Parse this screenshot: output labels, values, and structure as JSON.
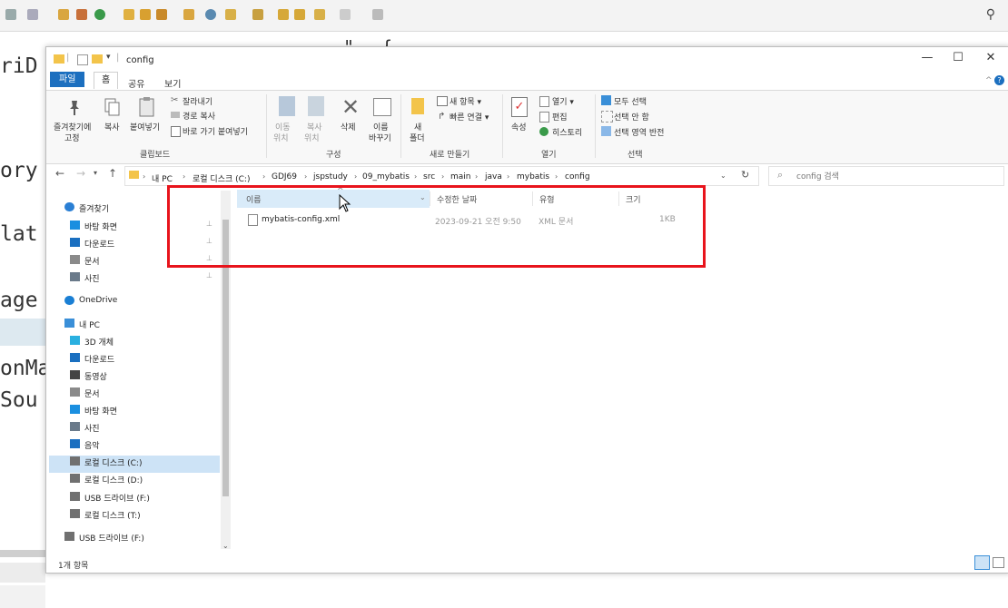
{
  "eclipse": {
    "search_icon": "search-icon",
    "code_lines": [
      "riD",
      "ory",
      "lat",
      "age",
      "onMa",
      "Sou"
    ],
    "code_fragment": "\"",
    "code_fragment2": "{"
  },
  "window": {
    "title": "config",
    "minimize": "—",
    "maximize": "☐",
    "close": "✕",
    "help": "?",
    "collapse": "^"
  },
  "ribbon": {
    "tabs": [
      "파일",
      "홈",
      "공유",
      "보기"
    ],
    "clipboard": {
      "pin_label_1": "즐겨찾기에",
      "pin_label_2": "고정",
      "copy": "복사",
      "paste": "붙여넣기",
      "cut": "잘라내기",
      "copy_path": "경로 복사",
      "paste_shortcut": "바로 가기 붙여넣기"
    },
    "organize": {
      "move_to_1": "이동",
      "move_to_2": "위치",
      "copy_to_1": "복사",
      "copy_to_2": "위치",
      "delete": "삭제",
      "rename_1": "이름",
      "rename_2": "바꾸기"
    },
    "new": {
      "new_folder_1": "새",
      "new_folder_2": "폴더",
      "new_item": "새 항목 ▾",
      "easy_access": "빠른 연결 ▾"
    },
    "open": {
      "properties": "속성",
      "open": "열기 ▾",
      "edit": "편집",
      "history": "히스토리"
    },
    "select": {
      "select_all": "모두 선택",
      "select_none": "선택 안 함",
      "invert": "선택 영역 반전"
    },
    "groups": [
      "클립보드",
      "구성",
      "새로 만들기",
      "열기",
      "선택"
    ]
  },
  "address": {
    "breadcrumbs": [
      "내 PC",
      "로컬 디스크 (C:)",
      "GDJ69",
      "jspstudy",
      "09_mybatis",
      "src",
      "main",
      "java",
      "mybatis",
      "config"
    ],
    "search_placeholder": "config 검색"
  },
  "nav": {
    "items": [
      {
        "label": "즐겨찾기",
        "icon": "star-icon",
        "color": "#2a7fd4"
      },
      {
        "label": "바탕 화면",
        "icon": "desktop-icon",
        "color": "#1a8fe0",
        "pinned": true
      },
      {
        "label": "다운로드",
        "icon": "download-icon",
        "color": "#1a6fc0",
        "pinned": true
      },
      {
        "label": "문서",
        "icon": "document-icon",
        "color": "#8a8a8a",
        "pinned": true
      },
      {
        "label": "사진",
        "icon": "pictures-icon",
        "color": "#6a7a8a",
        "pinned": true
      },
      {
        "label": "OneDrive",
        "icon": "cloud-icon",
        "color": "#1a7fd4"
      },
      {
        "label": "내 PC",
        "icon": "computer-icon",
        "color": "#3a8fd8"
      },
      {
        "label": "3D 개체",
        "icon": "cube-icon",
        "color": "#2ab0e0"
      },
      {
        "label": "다운로드",
        "icon": "download-icon",
        "color": "#1a6fc0"
      },
      {
        "label": "동영상",
        "icon": "video-icon",
        "color": "#444444"
      },
      {
        "label": "문서",
        "icon": "document-icon",
        "color": "#8a8a8a"
      },
      {
        "label": "바탕 화면",
        "icon": "desktop-icon",
        "color": "#1a8fe0"
      },
      {
        "label": "사진",
        "icon": "pictures-icon",
        "color": "#6a7a8a"
      },
      {
        "label": "음악",
        "icon": "music-icon",
        "color": "#1a6fc0"
      },
      {
        "label": "로컬 디스크 (C:)",
        "icon": "drive-icon",
        "color": "#707070"
      },
      {
        "label": "로컬 디스크 (D:)",
        "icon": "drive-icon",
        "color": "#707070"
      },
      {
        "label": "USB 드라이브 (F:)",
        "icon": "drive-icon",
        "color": "#707070"
      },
      {
        "label": "로컬 디스크 (T:)",
        "icon": "drive-icon",
        "color": "#707070"
      },
      {
        "label": "USB 드라이브 (F:)",
        "icon": "drive-icon",
        "color": "#707070"
      }
    ],
    "pin_glyph": "📌"
  },
  "files": {
    "columns": [
      "이름",
      "수정한 날짜",
      "유형",
      "크기"
    ],
    "rows": [
      {
        "name": "mybatis-config.xml",
        "modified": "2023-09-21 오전 9:50",
        "type": "XML 문서",
        "size": "1KB"
      }
    ]
  },
  "status": {
    "count": "1개 항목"
  },
  "colors": {
    "accent": "#1c6fbf",
    "highlight_box": "#e8141c",
    "selection": "#cde3f6"
  }
}
